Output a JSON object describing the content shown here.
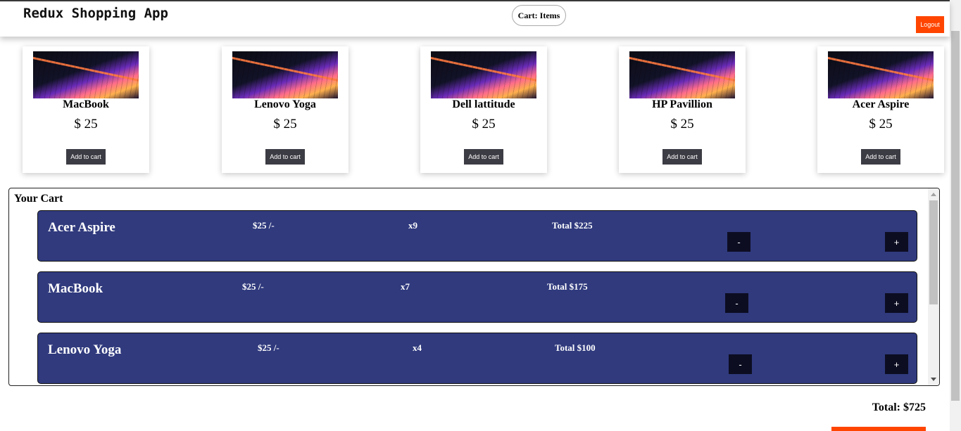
{
  "header": {
    "title": "Redux Shopping App",
    "cart_label": "Cart: Items",
    "logout_label": "Logout"
  },
  "products": [
    {
      "name": "MacBook",
      "price": "$ 25",
      "button": "Add to cart"
    },
    {
      "name": "Lenovo Yoga",
      "price": "$ 25",
      "button": "Add to cart"
    },
    {
      "name": "Dell lattitude",
      "price": "$ 25",
      "button": "Add to cart"
    },
    {
      "name": "HP Pavillion",
      "price": "$ 25",
      "button": "Add to cart"
    },
    {
      "name": "Acer Aspire",
      "price": "$ 25",
      "button": "Add to cart"
    }
  ],
  "cart": {
    "heading": "Your Cart",
    "items": [
      {
        "name": "Acer Aspire",
        "price": "$25 /-",
        "qty": "x9",
        "total": "Total $225",
        "decrement": "-",
        "increment": "+"
      },
      {
        "name": "MacBook",
        "price": "$25 /-",
        "qty": "x7",
        "total": "Total $175",
        "decrement": "-",
        "increment": "+"
      },
      {
        "name": "Lenovo Yoga",
        "price": "$25 /-",
        "qty": "x4",
        "total": "Total $100",
        "decrement": "-",
        "increment": "+"
      }
    ],
    "grand_total": "Total: $725"
  },
  "colors": {
    "accent": "#ff4500",
    "cart_item_bg": "#303a7d",
    "button_dark": "#0d0d22",
    "add_button": "#3c3c44"
  }
}
